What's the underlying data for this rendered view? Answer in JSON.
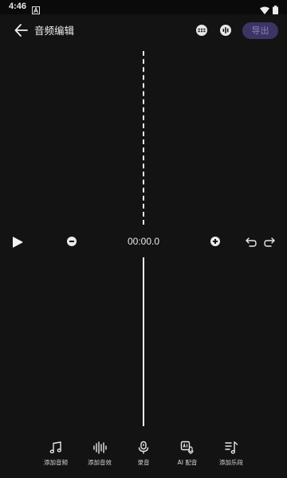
{
  "status_bar": {
    "time": "4:46",
    "notification_icon": "a-letter-icon",
    "wifi_icon": "wifi-icon",
    "battery_icon": "battery-icon"
  },
  "header": {
    "back_icon": "back-arrow-icon",
    "title": "音频编辑",
    "icons": [
      "grid-icon",
      "equalizer-icon"
    ],
    "export_label": "导出"
  },
  "player": {
    "play_icon": "play-icon",
    "zoom_out_icon": "minus-circle-icon",
    "time": "00:00.0",
    "zoom_in_icon": "plus-circle-icon",
    "undo_icon": "undo-icon",
    "redo_icon": "redo-icon"
  },
  "toolbar": {
    "items": [
      {
        "label": "添加音频",
        "icon": "music-note-icon"
      },
      {
        "label": "添加音效",
        "icon": "sound-wave-icon"
      },
      {
        "label": "录音",
        "icon": "microphone-icon"
      },
      {
        "label": "AI 配音",
        "icon": "ai-voice-icon"
      },
      {
        "label": "添加乐段",
        "icon": "music-list-icon"
      }
    ]
  },
  "colors": {
    "background": "#131313",
    "accent": "#3c3564",
    "accent_text": "#8a84b8"
  }
}
